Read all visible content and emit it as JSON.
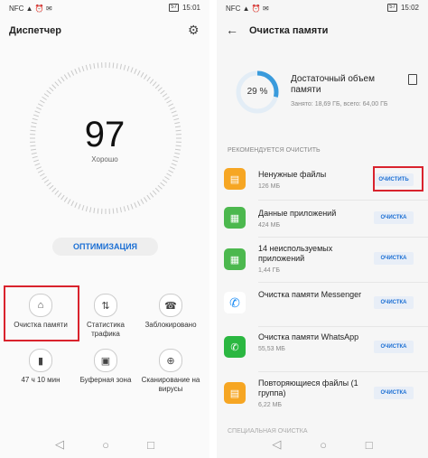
{
  "left": {
    "status": {
      "left": "NFC ▲ ⏰ ✉",
      "battery": "57",
      "time": "15:01"
    },
    "title": "Диспетчер",
    "score": "97",
    "score_label": "Хорошо",
    "optimize_label": "ОПТИМИЗАЦИЯ",
    "tiles": [
      {
        "label": "Очистка памяти",
        "icon": "broom-icon"
      },
      {
        "label": "Статистика трафика",
        "icon": "traffic-icon"
      },
      {
        "label": "Заблокировано",
        "icon": "blocked-icon"
      },
      {
        "label": "47 ч 10 мин",
        "icon": "battery-icon"
      },
      {
        "label": "Буферная зона",
        "icon": "buffer-icon"
      },
      {
        "label": "Сканирование на вирусы",
        "icon": "virus-scan-icon"
      }
    ]
  },
  "right": {
    "status": {
      "left": "NFC ▲ ⏰ ✉",
      "battery": "57",
      "time": "15:02"
    },
    "title": "Очистка памяти",
    "usage_percent": "29 %",
    "usage_fraction": 0.29,
    "storage_title": "Достаточный объем памяти",
    "storage_sub": "Занято: 18,69 ГБ, всего: 64,00 ГБ",
    "section": "РЕКОМЕНДУЕТСЯ ОЧИСТИТЬ",
    "items": [
      {
        "name": "Ненужные файлы",
        "size": "126 МБ",
        "btn": "ОЧИСТИТЬ",
        "color": "#f6a623",
        "icon": "file-icon"
      },
      {
        "name": "Данные приложений",
        "size": "424 МБ",
        "btn": "ОЧИСТКА",
        "color": "#4cb84e",
        "icon": "apps-icon"
      },
      {
        "name": "14 неиспользуемых приложений",
        "size": "1,44 ГБ",
        "btn": "ОЧИСТКА",
        "color": "#4cb84e",
        "icon": "apps-icon"
      },
      {
        "name": "Очистка памяти Messenger",
        "size": "",
        "btn": "ОЧИСТКА",
        "color": "#ffffff",
        "icon": "messenger-icon"
      },
      {
        "name": "Очистка памяти WhatsApp",
        "size": "55,53 МБ",
        "btn": "ОЧИСТКА",
        "color": "#2bb741",
        "icon": "whatsapp-icon"
      },
      {
        "name": "Повторяющиеся файлы (1 группа)",
        "size": "6,22 МБ",
        "btn": "ОЧИСТКА",
        "color": "#f6a623",
        "icon": "file-icon"
      }
    ],
    "next_section": "СПЕЦИАЛЬНАЯ ОЧИСТКА"
  },
  "nav": {
    "back": "◁",
    "home": "○",
    "recent": "□"
  },
  "colors": {
    "accent": "#1b6fd4",
    "highlight": "#d9232d",
    "progress": "#3a9bdc"
  }
}
